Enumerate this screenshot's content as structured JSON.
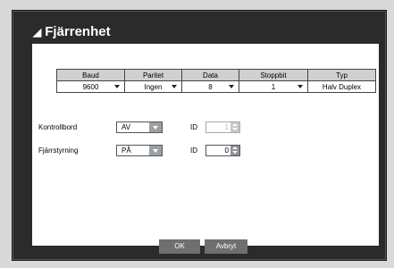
{
  "dialog": {
    "title": "Fjärrenhet",
    "title_icon": "signal-icon"
  },
  "table": {
    "headers": [
      "Baud",
      "Paritet",
      "Data",
      "Stoppbit",
      "Typ"
    ],
    "values": [
      "9600",
      "Ingen",
      "8",
      "1",
      "Halv Duplex"
    ]
  },
  "kontrollbord": {
    "label": "Kontrollbord",
    "value": "AV",
    "id_label": "ID",
    "id_value": "1"
  },
  "fjarrstyrning": {
    "label": "Fjärrstyrning",
    "value": "PÅ",
    "id_label": "ID",
    "id_value": "0"
  },
  "buttons": {
    "ok": "OK",
    "cancel": "Avbryt"
  }
}
